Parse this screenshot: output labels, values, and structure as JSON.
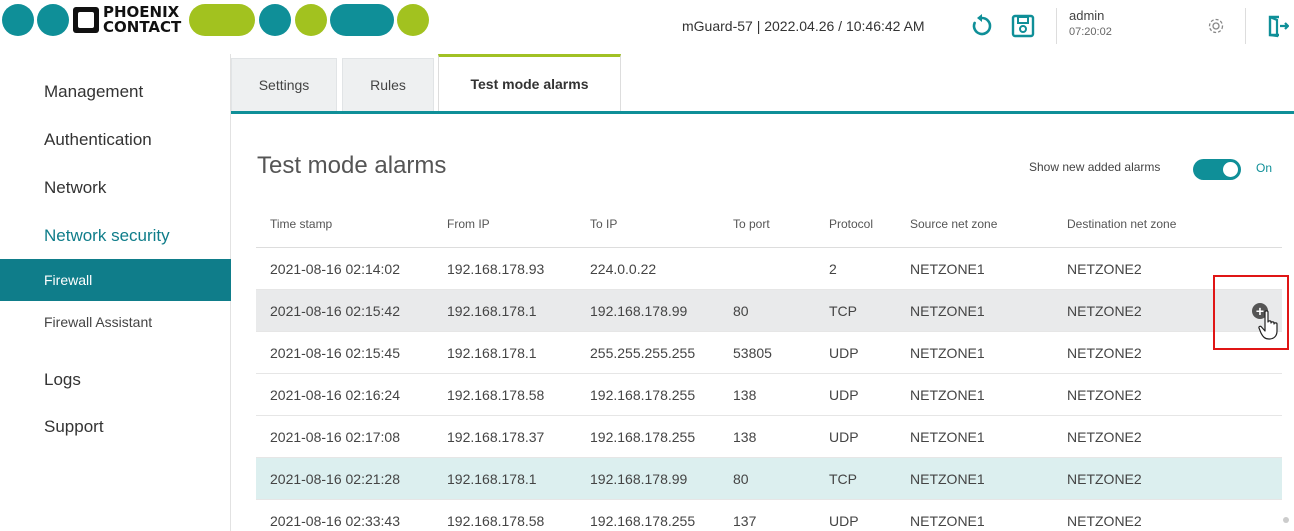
{
  "header": {
    "brand_text_line1": "PHOENIX",
    "brand_text_line2": "CONTACT",
    "device_info": "mGuard-57 | 2022.04.26 / 10:46:42 AM",
    "user": "admin",
    "session_time": "07:20:02",
    "brand_colors": {
      "green": "#a2c21f",
      "teal": "#0f8f98"
    }
  },
  "sidebar": {
    "items": [
      {
        "label": "Management"
      },
      {
        "label": "Authentication"
      },
      {
        "label": "Network"
      },
      {
        "label": "Network security"
      },
      {
        "label": "Firewall"
      },
      {
        "label": "Firewall Assistant"
      },
      {
        "label": "Logs"
      },
      {
        "label": "Support"
      }
    ]
  },
  "tabs": [
    {
      "label": "Settings"
    },
    {
      "label": "Rules"
    },
    {
      "label": "Test mode alarms"
    }
  ],
  "main": {
    "title": "Test mode alarms",
    "toggle_label": "Show new added alarms",
    "toggle_state": "On",
    "columns": [
      "Time stamp",
      "From IP",
      "To IP",
      "To port",
      "Protocol",
      "Source net zone",
      "Destination net zone"
    ],
    "rows": [
      [
        "2021-08-16 02:14:02",
        "192.168.178.93",
        "224.0.0.22",
        "",
        "2",
        "NETZONE1",
        "NETZONE2"
      ],
      [
        "2021-08-16 02:15:42",
        "192.168.178.1",
        "192.168.178.99",
        "80",
        "TCP",
        "NETZONE1",
        "NETZONE2"
      ],
      [
        "2021-08-16 02:15:45",
        "192.168.178.1",
        "255.255.255.255",
        "53805",
        "UDP",
        "NETZONE1",
        "NETZONE2"
      ],
      [
        "2021-08-16 02:16:24",
        "192.168.178.58",
        "192.168.178.255",
        "138",
        "UDP",
        "NETZONE1",
        "NETZONE2"
      ],
      [
        "2021-08-16 02:17:08",
        "192.168.178.37",
        "192.168.178.255",
        "138",
        "UDP",
        "NETZONE1",
        "NETZONE2"
      ],
      [
        "2021-08-16 02:21:28",
        "192.168.178.1",
        "192.168.178.99",
        "80",
        "TCP",
        "NETZONE1",
        "NETZONE2"
      ],
      [
        "2021-08-16 02:33:43",
        "192.168.178.58",
        "192.168.178.255",
        "137",
        "UDP",
        "NETZONE1",
        "NETZONE2"
      ]
    ]
  }
}
